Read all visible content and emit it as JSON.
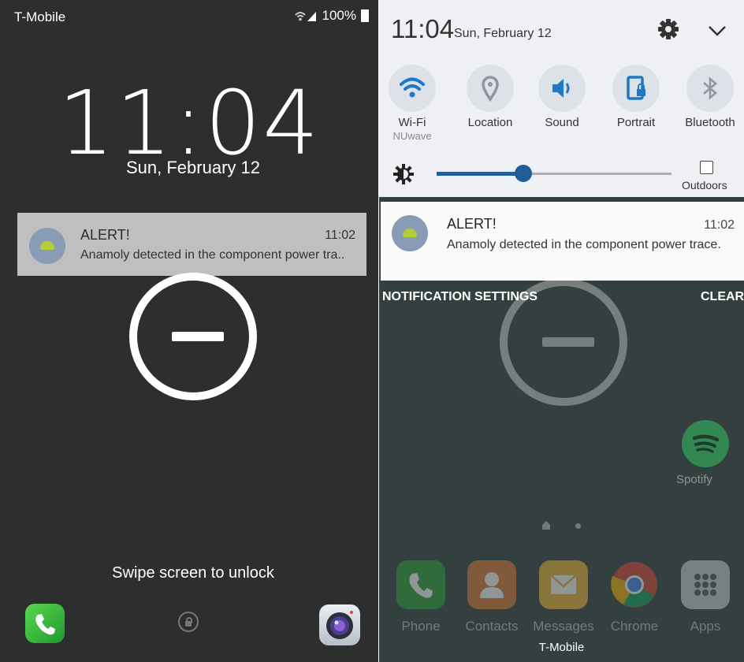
{
  "lock_screen": {
    "carrier": "T-Mobile",
    "battery": "100%",
    "time": "11:04",
    "date": "Sun, February 12",
    "notification": {
      "title": "ALERT!",
      "time": "11:02",
      "body": "Anamoly detected in the component power tra.."
    },
    "swipe_hint": "Swipe screen to unlock",
    "icons": [
      "phone-icon",
      "unlock-icon",
      "camera-icon",
      "do-not-disturb-icon"
    ]
  },
  "notification_shade": {
    "time": "11:04",
    "date": "Sun, February 12",
    "quick_settings": [
      {
        "label": "Wi-Fi",
        "sub": "NUwave",
        "icon": "wifi-icon",
        "active": true
      },
      {
        "label": "Location",
        "sub": "",
        "icon": "location-icon",
        "active": false
      },
      {
        "label": "Sound",
        "sub": "",
        "icon": "sound-icon",
        "active": true
      },
      {
        "label": "Portrait",
        "sub": "",
        "icon": "portrait-lock-icon",
        "active": true
      },
      {
        "label": "Bluetooth",
        "sub": "",
        "icon": "bluetooth-icon",
        "active": false
      }
    ],
    "brightness_level": 0.37,
    "outdoors_label": "Outdoors",
    "notification": {
      "title": "ALERT!",
      "time": "11:02",
      "body": "Anamoly detected in the component power trace."
    },
    "notification_settings_label": "NOTIFICATION SETTINGS",
    "clear_label": "CLEAR",
    "home_apps": {
      "spotify": "Spotify"
    },
    "dock": [
      "Phone",
      "Contacts",
      "Messages",
      "Chrome",
      "Apps"
    ],
    "dock_carrier": "T-Mobile"
  },
  "colors": {
    "lock_bg": "#2d2f2e",
    "shade_bg": "#eef0f3",
    "accent_blue": "#1f5e97",
    "home_bg": "#33403f"
  }
}
